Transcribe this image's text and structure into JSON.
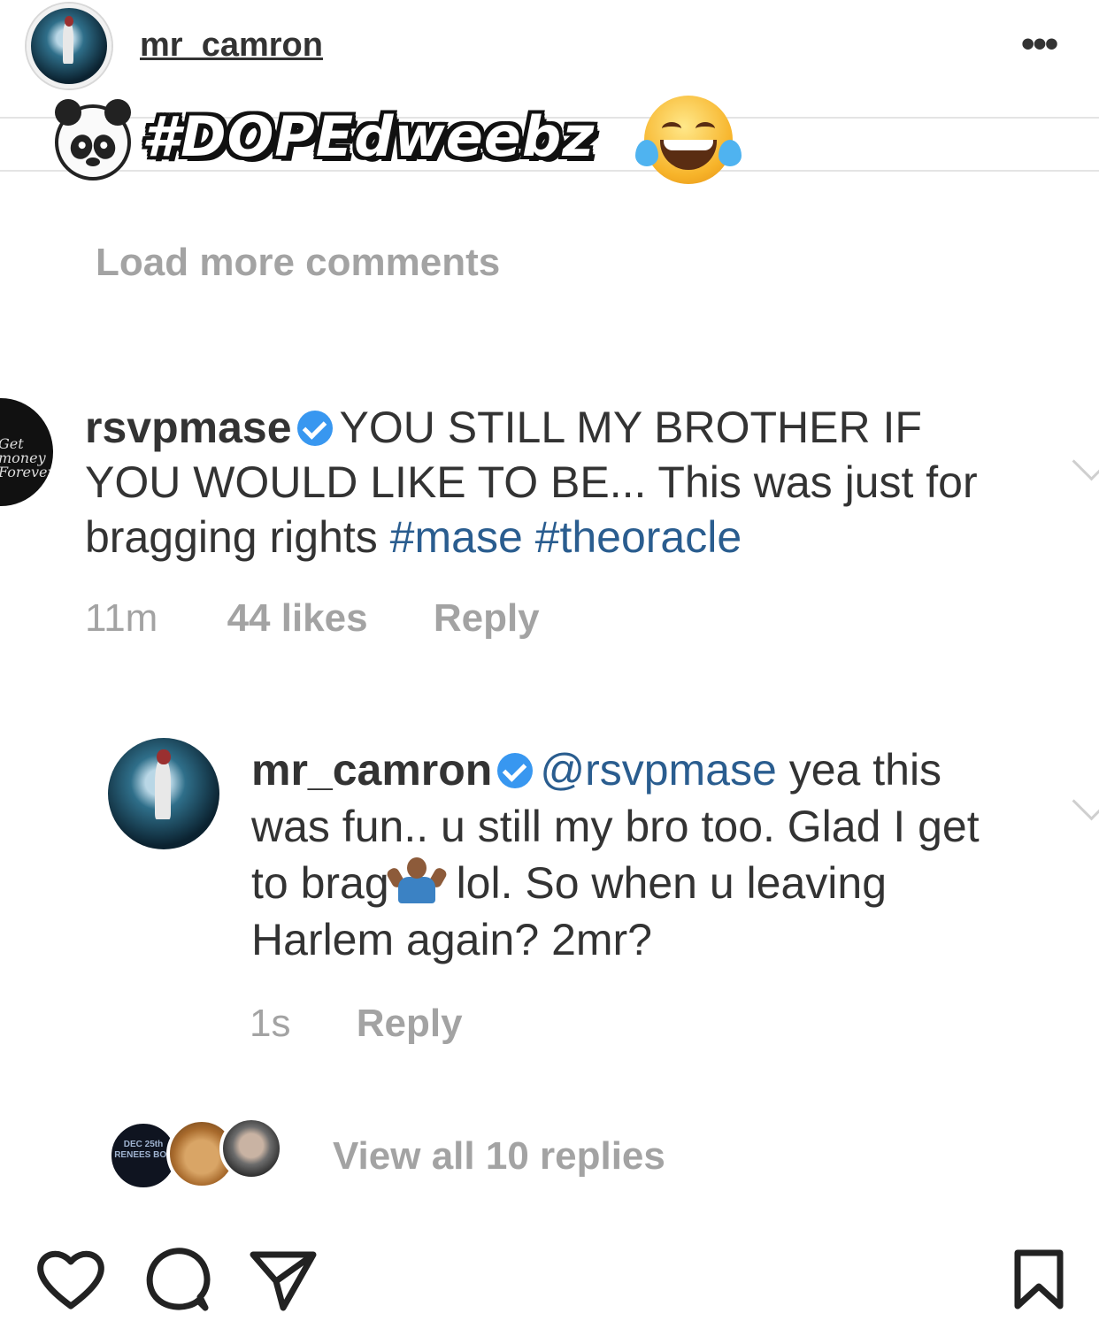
{
  "post": {
    "username": "mr_camron",
    "more_icon": "more-dots-icon"
  },
  "watermark": {
    "text": "#DOPEdweebz",
    "left_emoji": "panda-face",
    "right_emoji": "face-with-tears-of-joy"
  },
  "comments": {
    "load_more": "Load more comments",
    "main": {
      "username": "rsvpmase",
      "verified": true,
      "text": "YOU STILL MY BROTHER IF YOU WOULD LIKE TO BE... This was just for bragging rights",
      "hashtags": [
        "#mase",
        "#theoracle"
      ],
      "time": "11m",
      "likes": "44 likes",
      "reply_label": "Reply",
      "avatar_text": "Get money Forever"
    },
    "reply": {
      "username": "mr_camron",
      "verified": true,
      "mention": "@rsvpmase",
      "text_part1": "yea this was fun.. u still my bro too. Glad I get to brag",
      "emoji": "person-shrugging",
      "text_part2": "lol. So when u leaving Harlem again? 2mr?",
      "time": "1s",
      "reply_label": "Reply"
    },
    "view_all": "View all 10 replies",
    "reply_avatar_text": "DEC 25th RENEES BOY"
  },
  "actions": {
    "like_icon": "heart-icon",
    "comment_icon": "comment-icon",
    "share_icon": "send-icon",
    "save_icon": "bookmark-icon"
  }
}
